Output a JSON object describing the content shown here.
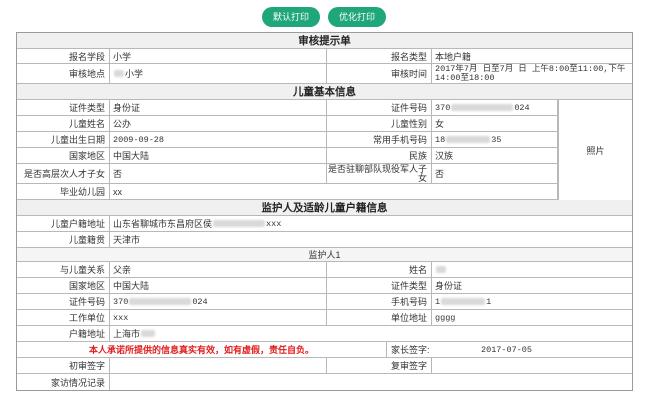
{
  "toolbar": {
    "default_print": "默认打印",
    "optimized_print": "优化打印"
  },
  "review": {
    "title": "审核提示单",
    "school_label": "报名学段",
    "school_value": "小学",
    "type_label": "报名类型",
    "type_value": "本地户籍",
    "place_label": "审核地点",
    "place_value": "小学",
    "time_label": "审核时间",
    "time_value": "2017年7月 日至7月 日 上午8:00至11:00,下午14:00至18:00"
  },
  "child": {
    "title": "儿童基本信息",
    "id_type_label": "证件类型",
    "id_type_value": "身份证",
    "id_no_label": "证件号码",
    "id_no_prefix": "370",
    "id_no_suffix": "024",
    "name_label": "儿童姓名",
    "name_value": "公办",
    "gender_label": "儿童性别",
    "gender_value": "女",
    "birth_label": "儿童出生日期",
    "birth_value": "2009-09-28",
    "phone_label": "常用手机号码",
    "phone_prefix": "18",
    "phone_suffix": "35",
    "region_label": "国家地区",
    "region_value": "中国大陆",
    "ethnic_label": "民族",
    "ethnic_value": "汉族",
    "talent_label": "是否高层次人才子女",
    "talent_value": "否",
    "military_label": "是否驻聊部队现役军人子女",
    "military_value": "否",
    "kinder_label": "毕业幼儿园",
    "kinder_value": "xx",
    "photo_label": "照片"
  },
  "guardian": {
    "title": "监护人及适龄儿童户籍信息",
    "hukou_addr_label": "儿童户籍地址",
    "hukou_addr_prefix": "山东省聊城市东昌府区侯",
    "hukou_addr_suffix": "xxx",
    "hukou_label": "儿童籍贯",
    "hukou_value": "天津市",
    "guardian1_title": "监护人1",
    "relation_label": "与儿童关系",
    "relation_value": "父亲",
    "g_name_label": "姓名",
    "g_region_label": "国家地区",
    "g_region_value": "中国大陆",
    "g_id_type_label": "证件类型",
    "g_id_type_value": "身份证",
    "g_id_no_label": "证件号码",
    "g_id_no_prefix": "370",
    "g_id_no_suffix": "024",
    "g_phone_label": "手机号码",
    "g_phone_prefix": "1",
    "g_phone_suffix": "1",
    "work_label": "工作单位",
    "work_value": "xxx",
    "work_addr_label": "单位地址",
    "work_addr_value": "gggg",
    "addr_label": "户籍地址",
    "addr_value": "上海市"
  },
  "footer": {
    "promise": "本人承诺所提供的信息真实有效，如有虚假，责任自负。",
    "parent_sign_label": "家长签字:",
    "date_value": "2017-07-05",
    "first_sign_label": "初审签字",
    "second_sign_label": "复审签字",
    "visit_label": "家访情况记录"
  }
}
